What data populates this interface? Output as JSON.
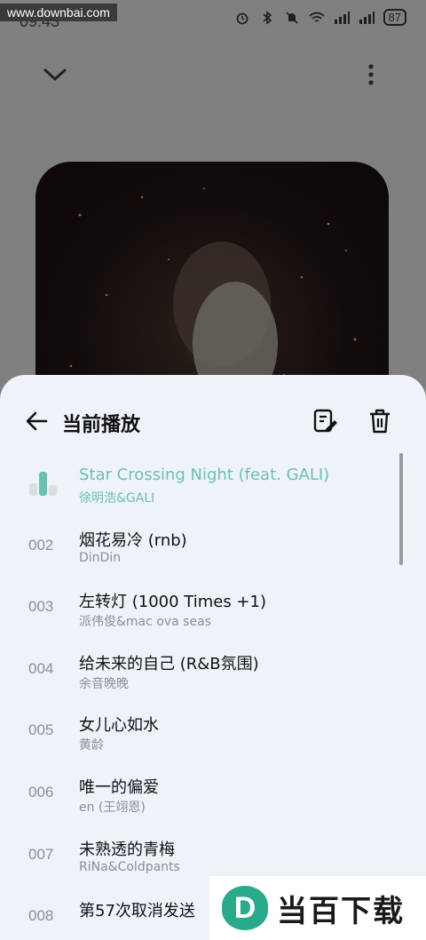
{
  "status_bar": {
    "watermark": "www.downbai.com",
    "time": "09:43",
    "battery": "87"
  },
  "sheet": {
    "title": "当前播放"
  },
  "playlist": [
    {
      "number": "",
      "title": "Star Crossing Night (feat. GALI)",
      "artist": "徐明浩&GALI",
      "active": true
    },
    {
      "number": "002",
      "title": "烟花易冷 (rnb)",
      "artist": "DinDin"
    },
    {
      "number": "003",
      "title": "左转灯 (1000 Times +1)",
      "artist": "派伟俊&mac ova seas"
    },
    {
      "number": "004",
      "title": "给未来的自己 (R&B氛围)",
      "artist": "余音晚晚"
    },
    {
      "number": "005",
      "title": "女儿心如水",
      "artist": "黄龄"
    },
    {
      "number": "006",
      "title": "唯一的偏爱",
      "artist": "en (王翊恩)"
    },
    {
      "number": "007",
      "title": "未熟透的青梅",
      "artist": "RiNa&Coldpants"
    },
    {
      "number": "008",
      "title": "第57次取消发送",
      "artist": ""
    }
  ],
  "watermark_logo": {
    "badge": "D",
    "text": "当百下载"
  },
  "colors": {
    "accent": "#6dbfb0",
    "sheet_bg": "#eef3f9",
    "overlay": "#808080"
  }
}
